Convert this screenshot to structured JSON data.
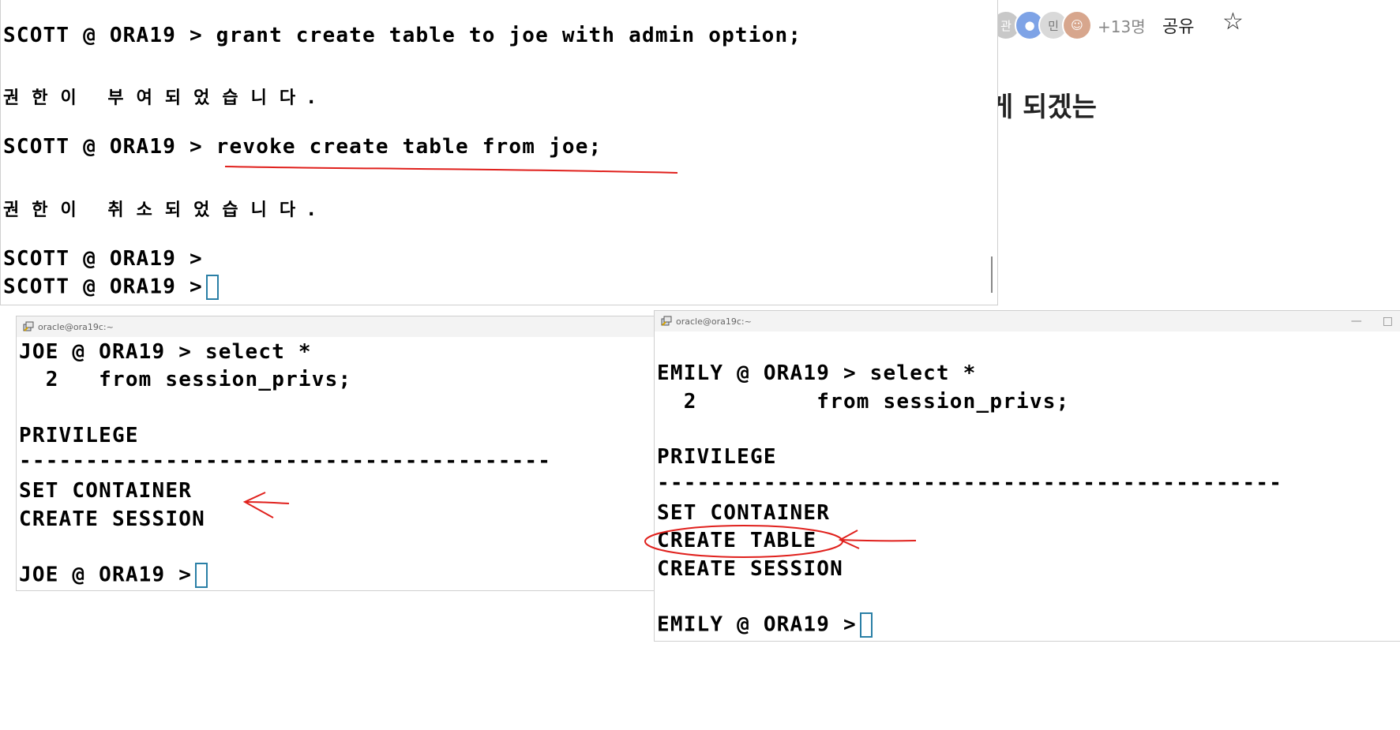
{
  "background_doc": {
    "avatar_initials": [
      "관",
      "민"
    ],
    "member_count": "+13명",
    "share_label": "공유",
    "star": "☆",
    "heading_fragment": "게 되겠는"
  },
  "main_terminal": {
    "lines": [
      "SCOTT @ ORA19 > grant create table to joe with admin option;",
      "권한이 부여되었습니다.",
      "SCOTT @ ORA19 > revoke create table from joe;",
      "권한이 취소되었습니다.",
      "SCOTT @ ORA19 >",
      "SCOTT @ ORA19 >"
    ]
  },
  "joe_terminal": {
    "title": "oracle@ora19c:~",
    "lines": [
      "JOE @ ORA19 > select *",
      "  2   from session_privs;",
      "PRIVILEGE",
      "----------------------------------------",
      "SET CONTAINER",
      "CREATE SESSION",
      "JOE @ ORA19 >"
    ]
  },
  "emily_terminal": {
    "title": "oracle@ora19c:~",
    "lines": [
      "EMILY @ ORA19 > select *",
      "  2         from session_privs;",
      "PRIVILEGE",
      "-----------------------------------------------",
      "SET CONTAINER",
      "CREATE TABLE",
      "CREATE SESSION",
      "EMILY @ ORA19 >"
    ]
  },
  "colors": {
    "annotation": "#e0201c",
    "cursor": "#2a7fa6"
  }
}
